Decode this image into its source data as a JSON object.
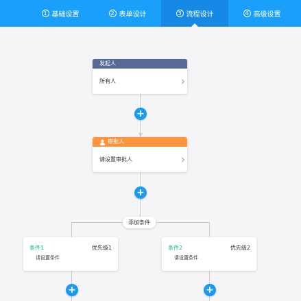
{
  "steps": [
    {
      "num": "1",
      "label": "基础设置"
    },
    {
      "num": "2",
      "label": "表单设计"
    },
    {
      "num": "3",
      "label": "流程设计"
    },
    {
      "num": "4",
      "label": "高级设置"
    }
  ],
  "active_step": "流程设计",
  "flow": {
    "starter": {
      "header": "发起人",
      "body": "所有人"
    },
    "approver": {
      "header": "审批人",
      "body": "请设置审批人"
    },
    "add_condition_label": "添加条件",
    "conditions": [
      {
        "title": "条件1",
        "priority": "优先级1",
        "desc": "请设置条件"
      },
      {
        "title": "条件2",
        "priority": "优先级2",
        "desc": "请设置条件"
      }
    ],
    "add_button_glyph": "+"
  },
  "colors": {
    "topbar": "#1aa0fa",
    "active_step": "#1688e5",
    "starter_header": "#576a95",
    "approver_header": "#ff943e",
    "add_button": "#1a9bf0",
    "condition_title": "#15bc83"
  },
  "icons": {
    "node_chevron": "chevron-right-icon",
    "approver": "user-icon",
    "add": "plus-icon"
  }
}
